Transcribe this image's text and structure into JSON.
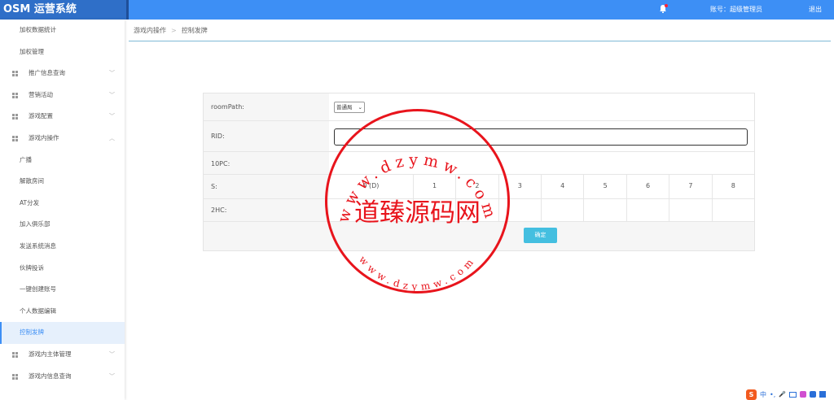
{
  "app": {
    "title": "OSM 运营系统"
  },
  "header": {
    "account": "账号：超级管理员",
    "logout": "退出"
  },
  "sidebar": {
    "items": [
      {
        "label": "加权数据统计",
        "type": "leaf"
      },
      {
        "label": "加权管理",
        "type": "leaf"
      },
      {
        "label": "推广信息查询",
        "type": "group",
        "chevron": "﹀"
      },
      {
        "label": "营销活动",
        "type": "group",
        "chevron": "﹀"
      },
      {
        "label": "游戏配置",
        "type": "group",
        "chevron": "﹀"
      },
      {
        "label": "游戏内操作",
        "type": "group",
        "chevron": "︿"
      },
      {
        "label": "广播",
        "type": "leaf"
      },
      {
        "label": "解散房间",
        "type": "leaf"
      },
      {
        "label": "AT分发",
        "type": "leaf"
      },
      {
        "label": "加入俱乐部",
        "type": "leaf"
      },
      {
        "label": "发送系统消息",
        "type": "leaf"
      },
      {
        "label": "伙牌投诉",
        "type": "leaf"
      },
      {
        "label": "一键创建账号",
        "type": "leaf"
      },
      {
        "label": "个人数据编辑",
        "type": "leaf"
      },
      {
        "label": "控制发牌",
        "type": "leaf",
        "active": true
      },
      {
        "label": "游戏内主体管理",
        "type": "group",
        "chevron": "﹀"
      },
      {
        "label": "游戏内信息查询",
        "type": "group",
        "chevron": "﹀"
      }
    ]
  },
  "breadcrumb": {
    "parent": "游戏内操作",
    "separator": ">",
    "current": "控制发牌"
  },
  "form": {
    "room_path_label": "roomPath:",
    "room_path_value": "普通局",
    "rid_label": "RID:",
    "rid_value": "",
    "tenpc_label": "10PC:",
    "s_label": "S:",
    "s_cells": [
      "0  (D)",
      "1",
      "2",
      "3",
      "4",
      "5",
      "6",
      "7",
      "8"
    ],
    "twohc_label": "2HC:",
    "confirm_label": "确定"
  },
  "watermark": {
    "text": "道臻源码网",
    "ring_top": "www.dzymw.com",
    "ring_bottom": "www.dzymw.com",
    "color": "#e8141c"
  },
  "tray": {
    "ime": "中",
    "punct": "•,",
    "mic": "🎤"
  },
  "colors": {
    "accent": "#3d8ff5",
    "logo_bg": "#2f6fc8",
    "confirm": "#44bfe0"
  }
}
